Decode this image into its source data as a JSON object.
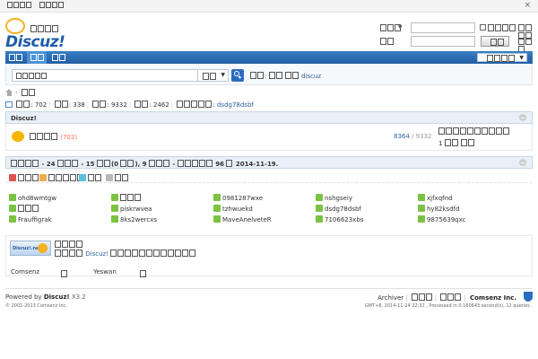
{
  "top_bar": {
    "links": [
      "",
      ""
    ],
    "close_icon": "×"
  },
  "header": {
    "logo_cn": "",
    "logo_word": "Discuz!",
    "login": {
      "username_label": "",
      "username_value": "",
      "remember_label": "",
      "password_label": "",
      "password_value": "",
      "login_button": "",
      "register_label": ""
    }
  },
  "nav": {
    "tabs": [
      "",
      "",
      ""
    ],
    "active_index": 1,
    "quick_nav_label": ""
  },
  "search": {
    "input_value": "",
    "scope_label": "",
    "hot_label": "",
    "hot_terms": [
      "",
      "",
      "discuz"
    ]
  },
  "breadcrumb": {
    "separator": "›",
    "current": ""
  },
  "stats": {
    "items": [
      {
        "label": "",
        "value": "702"
      },
      {
        "label": "",
        "value": "338"
      },
      {
        "label": "",
        "value": "9332"
      },
      {
        "label": "",
        "value": "2462"
      },
      {
        "label": "",
        "value": "dsdg78dsbf"
      }
    ]
  },
  "forum_panel": {
    "title": "Discuz!",
    "forum_name": "",
    "forum_today_count": "(702)",
    "threads": "8364",
    "posts": "9332",
    "last_post_title": "",
    "last_post_meta": "1"
  },
  "online_panel": {
    "header_text": "- 24 - 15 (0 ), 9 - 96 2014-11-19.",
    "legend": [
      {
        "icon": "user-red-icon",
        "label": ""
      },
      {
        "icon": "user-orange-icon",
        "label": ""
      },
      {
        "icon": "user-cyan-icon",
        "label": ""
      },
      {
        "icon": "user-grey-icon",
        "label": ""
      }
    ],
    "users": [
      "ohd8wmtgw",
      "",
      "0981287wxe",
      "nshgseiy",
      "xjfxqfnd",
      "",
      "piskrwvea",
      "tzhwuekd",
      "dsdg78dsbf",
      "hy82ksdfd",
      "Frauffigrak",
      "8ks2wercxs",
      "MaveAnelveteR",
      "7106623xbs",
      "9875639qxc"
    ]
  },
  "links_panel": {
    "logo_text": "Discuz!.net",
    "title": "",
    "desc_prefix": "",
    "desc_brand": "Discuz!",
    "desc_suffix": "",
    "partners": [
      "Comsenz",
      "",
      "Yeswan",
      ""
    ]
  },
  "footer": {
    "powered_by": "Powered by",
    "brand": "Discuz!",
    "version": "X3.2",
    "copyright": "© 2001-2013 Comsenz Inc.",
    "links": [
      "Archiver",
      "",
      "",
      "Comsenz Inc."
    ],
    "gmt": "GMT+8, 2014-11-24 22:32 , Processed in 0.160643 second(s), 12 queries ."
  }
}
